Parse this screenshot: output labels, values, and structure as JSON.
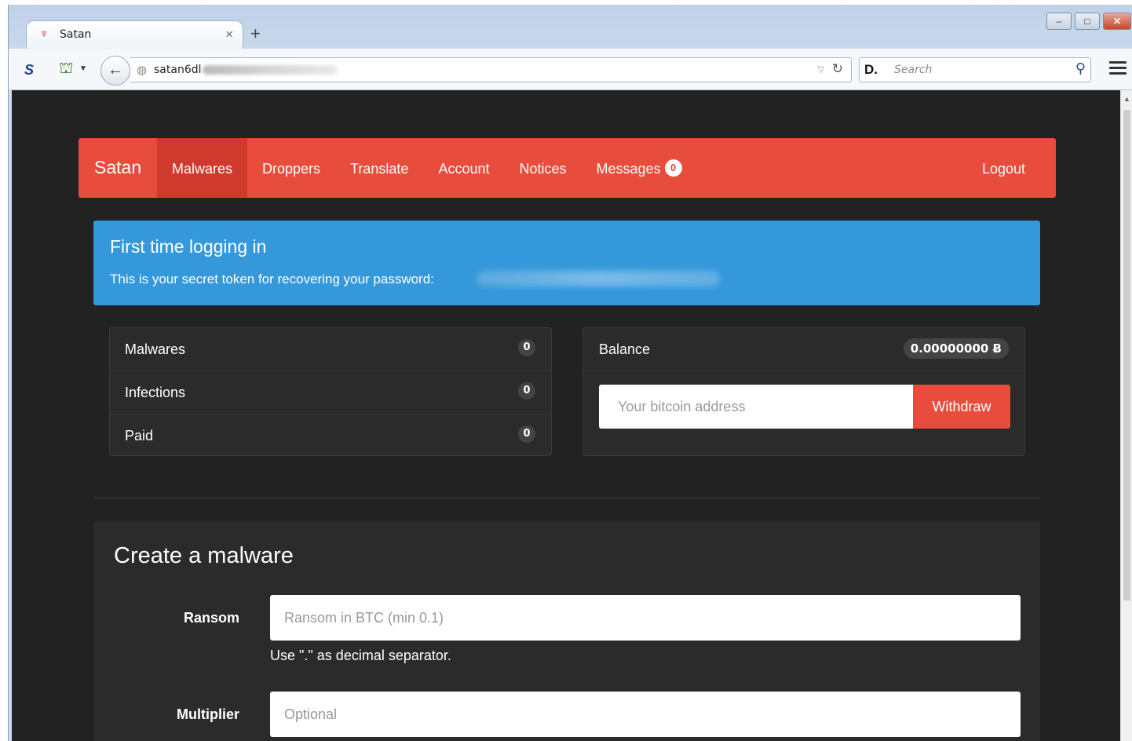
{
  "browser": {
    "tab_title": "Satan",
    "tab_close": "×",
    "new_tab": "+",
    "url_visible": "satan6dl",
    "search_placeholder": "Search",
    "search_engine_glyph": "D.",
    "window_buttons": [
      "–",
      "□",
      "✕"
    ]
  },
  "app": {
    "brand": "Satan",
    "nav": [
      {
        "label": "Malwares",
        "active": true
      },
      {
        "label": "Droppers"
      },
      {
        "label": "Translate"
      },
      {
        "label": "Account"
      },
      {
        "label": "Notices"
      },
      {
        "label": "Messages",
        "badge": "0"
      }
    ],
    "logout": "Logout"
  },
  "alert": {
    "title": "First time logging in",
    "message": "This is your secret token for recovering your password:"
  },
  "stats": [
    {
      "label": "Malwares",
      "count": "0"
    },
    {
      "label": "Infections",
      "count": "0"
    },
    {
      "label": "Paid",
      "count": "0"
    }
  ],
  "balance": {
    "label": "Balance",
    "value": "0.00000000 Ƀ",
    "address_placeholder": "Your bitcoin address",
    "withdraw_label": "Withdraw"
  },
  "create_form": {
    "title": "Create a malware",
    "ransom_label": "Ransom",
    "ransom_placeholder": "Ransom in BTC (min 0.1)",
    "ransom_help": "Use \".\" as decimal separator.",
    "multiplier_label": "Multiplier",
    "multiplier_placeholder": "Optional"
  },
  "colors": {
    "nav_red": "#e74c3c",
    "alert_blue": "#3498db",
    "page_bg": "#222222",
    "panel_bg": "#2b2b2b"
  }
}
